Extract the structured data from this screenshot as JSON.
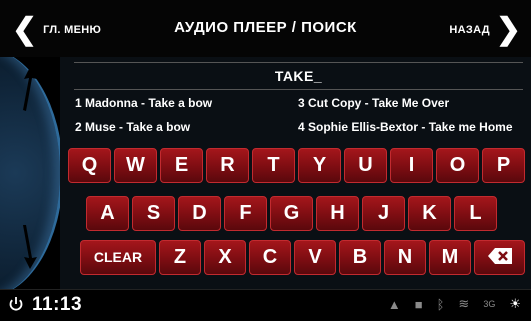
{
  "header": {
    "left_label": "ГЛ. МЕНЮ",
    "title": "АУДИО ПЛЕЕР / ПОИСК",
    "right_label": "НАЗАД"
  },
  "search": {
    "value": "TAKE_"
  },
  "results": [
    {
      "label": "1 Madonna - Take a bow"
    },
    {
      "label": "2 Muse - Take a bow"
    },
    {
      "label": "3 Cut Copy - Take Me Over"
    },
    {
      "label": "4 Sophie Ellis-Bextor - Take me Home"
    }
  ],
  "keyboard": {
    "row1": [
      "Q",
      "W",
      "E",
      "R",
      "T",
      "Y",
      "U",
      "I",
      "O",
      "P"
    ],
    "row2": [
      "A",
      "S",
      "D",
      "F",
      "G",
      "H",
      "J",
      "K",
      "L"
    ],
    "clear_label": "CLEAR",
    "row3": [
      "Z",
      "X",
      "C",
      "V",
      "B",
      "N",
      "M"
    ]
  },
  "status": {
    "time": "11:13",
    "signal_label": "3G"
  },
  "colors": {
    "key_red": "#a4161b",
    "accent_blue": "#2e6a9a"
  }
}
